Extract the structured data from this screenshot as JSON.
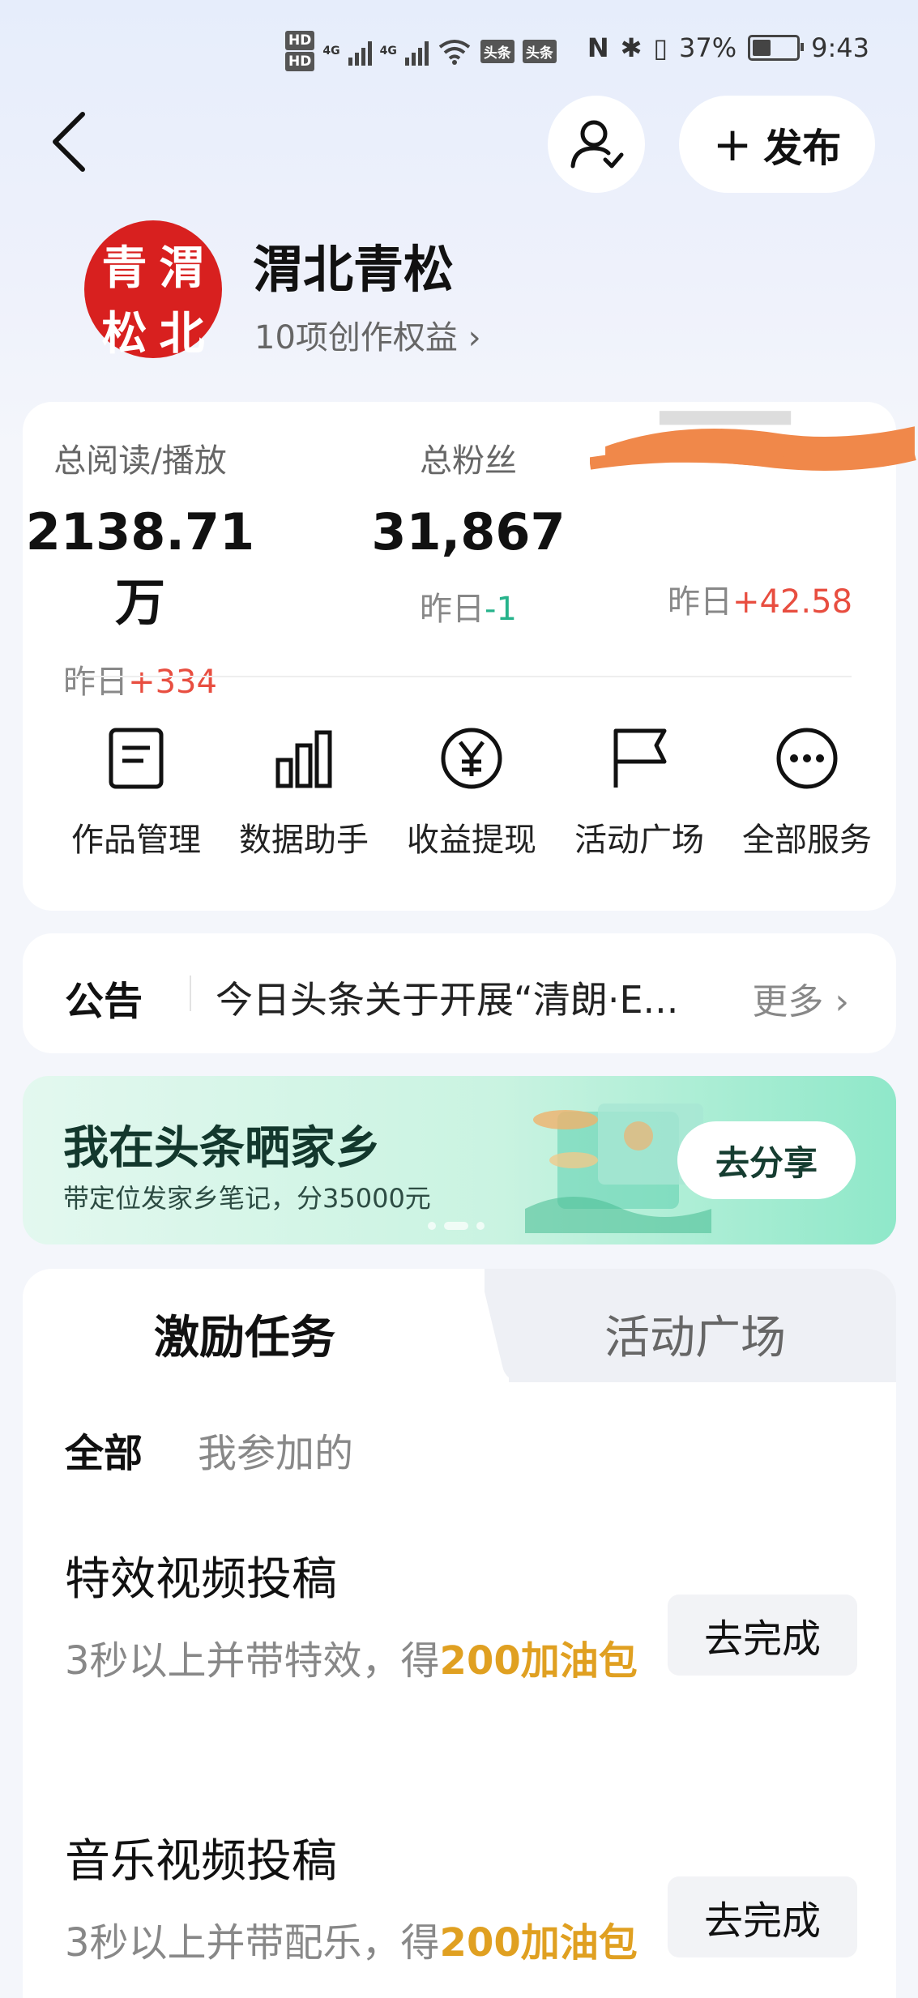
{
  "status_bar": {
    "net_badges": [
      "HD",
      "HD"
    ],
    "net_types": [
      "4G",
      "4G"
    ],
    "app_tags": [
      "头条",
      "头条"
    ],
    "battery": "37%",
    "time": "9:43"
  },
  "header": {
    "back_icon": "chevron-left",
    "follow_icon": "user-check",
    "publish_label": "发布"
  },
  "profile": {
    "avatar_chars": [
      "青",
      "渭",
      "松",
      "北"
    ],
    "avatar_color": "#d8201f",
    "name": "渭北青松",
    "benefit": "10项创作权益 ›"
  },
  "stats": [
    {
      "label": "总阅读/播放",
      "value": "2138.71万",
      "yday_prefix": "昨日",
      "yday_delta": "+334"
    },
    {
      "label": "总粉丝",
      "value": "31,867",
      "yday_prefix": "昨日",
      "yday_delta": "-1"
    },
    {
      "label": "",
      "value": "",
      "yday_prefix": "昨日",
      "yday_delta": "+42.58"
    }
  ],
  "services": [
    {
      "label": "作品管理",
      "icon": "document-icon"
    },
    {
      "label": "数据助手",
      "icon": "bar-chart-icon"
    },
    {
      "label": "收益提现",
      "icon": "yuan-icon"
    },
    {
      "label": "活动广场",
      "icon": "flag-icon"
    },
    {
      "label": "全部服务",
      "icon": "more-icon"
    }
  ],
  "notice": {
    "title": "公告",
    "text": "今日头条关于开展“清朗·E...",
    "more": "更多 ›"
  },
  "banner": {
    "title": "我在头条晒家乡",
    "subtitle": "带定位发家乡笔记，分35000元",
    "button": "去分享"
  },
  "tasks": {
    "tabs": [
      "激励任务",
      "活动广场"
    ],
    "subtabs": [
      "全部",
      "我参加的"
    ],
    "items": [
      {
        "title": "特效视频投稿",
        "desc_prefix": "3秒以上并带特效，得",
        "reward": "200加油包",
        "button": "去完成"
      },
      {
        "title": "音乐视频投稿",
        "desc_prefix": "3秒以上并带配乐，得",
        "reward": "200加油包",
        "button": "去完成"
      }
    ]
  },
  "colors": {
    "up": "#e84e40",
    "down": "#26b38b",
    "reward": "#e0a021"
  }
}
